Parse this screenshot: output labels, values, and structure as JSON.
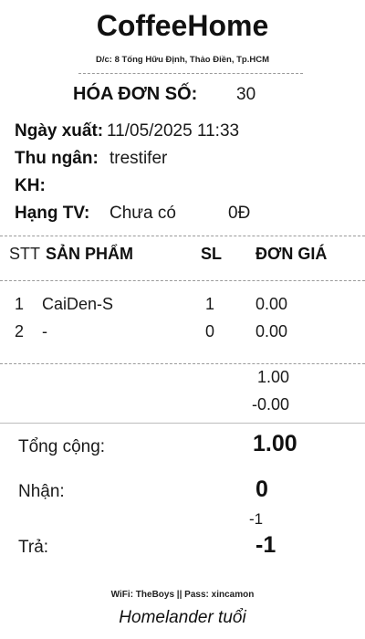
{
  "store": {
    "name": "CoffeeHome",
    "address": "D/c: 8 Tống Hữu Định, Thảo Điền, Tp.HCM"
  },
  "invoice": {
    "title_label": "HÓA ĐƠN SỐ:",
    "number": "30"
  },
  "info": {
    "date_label": "Ngày xuất:",
    "date_value": "11/05/2025 11:33",
    "cashier_label": "Thu ngân:",
    "cashier_value": "trestifer",
    "customer_label": "KH:",
    "customer_value": "",
    "tier_label": "Hạng TV:",
    "tier_value": "Chưa có",
    "tier_points": "0Đ"
  },
  "table": {
    "headers": {
      "stt": "STT",
      "product": "SẢN PHẨM",
      "qty": "SL",
      "price": "ĐƠN GIÁ"
    },
    "rows": [
      {
        "stt": "1",
        "product": "CaiDen-S",
        "qty": "1",
        "price": "0.00"
      },
      {
        "stt": "2",
        "product": "-",
        "qty": "0",
        "price": "0.00"
      }
    ]
  },
  "subtotals": {
    "subtotal": "1.00",
    "discount": "-0.00"
  },
  "totals": {
    "total_label": "Tổng cộng:",
    "total_value": "1.00",
    "received_label": "Nhận:",
    "received_value": "0",
    "change_small": "-1",
    "change_label": "Trả:",
    "change_value": "-1"
  },
  "footer": {
    "wifi": "WiFi: TheBoys || Pass: xincamon",
    "signature": "Homelander tuổi"
  }
}
